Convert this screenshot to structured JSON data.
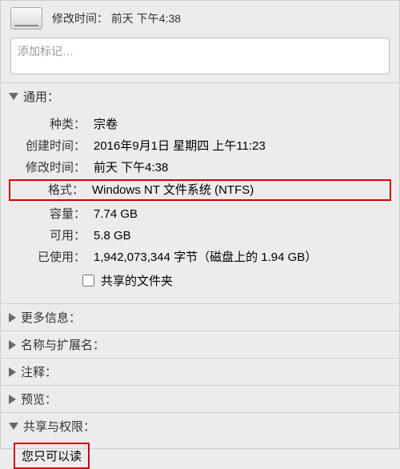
{
  "top": {
    "modified_label": "修改时间：",
    "modified_value": "前天 下午4:38"
  },
  "tags_placeholder": "添加标记…",
  "sections": {
    "general": {
      "title": "通用：",
      "rows": {
        "kind_label": "种类：",
        "kind_value": "宗卷",
        "created_label": "创建时间：",
        "created_value": "2016年9月1日 星期四 上午11:23",
        "modified_label": "修改时间：",
        "modified_value": "前天 下午4:38",
        "format_label": "格式：",
        "format_value": "Windows NT 文件系统 (NTFS)",
        "capacity_label": "容量：",
        "capacity_value": "7.74 GB",
        "available_label": "可用：",
        "available_value": "5.8 GB",
        "used_label": "已使用：",
        "used_value": "1,942,073,344 字节（磁盘上的 1.94 GB）",
        "shared_label": "共享的文件夹"
      }
    },
    "more_info": "更多信息：",
    "name_ext": "名称与扩展名：",
    "comments": "注释：",
    "preview": "预览：",
    "sharing": {
      "title": "共享与权限：",
      "permission": "您只可以读"
    }
  }
}
